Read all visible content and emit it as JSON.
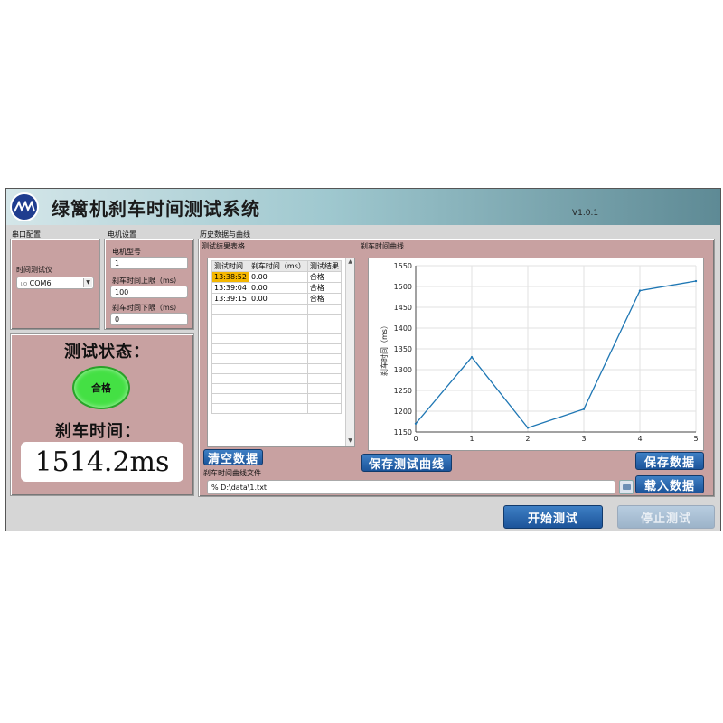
{
  "app": {
    "title": "绿篱机刹车时间测试系统",
    "version": "V1.0.1"
  },
  "sections": {
    "serial": "串口配置",
    "motor": "电机设置",
    "history": "历史数据与曲线",
    "results_table": "测试结果表格",
    "brake_chart": "刹车时间曲线"
  },
  "serial": {
    "instrument_label": "时间测试仪",
    "port_value": "COM6",
    "port_prefix": "I/O"
  },
  "motor": {
    "model_label": "电机型号",
    "model_value": "1",
    "upper_label": "刹车时间上限（ms）",
    "upper_value": "100",
    "lower_label": "刹车时间下限（ms）",
    "lower_value": "0"
  },
  "status": {
    "status_title": "测试状态：",
    "indicator_text": "合格",
    "brake_title": "刹车时间：",
    "brake_value": "1514.2ms",
    "indicator_color": "#44e044"
  },
  "table": {
    "headers": [
      "测试时间",
      "刹车时间（ms）",
      "测试结果"
    ],
    "rows": [
      [
        "13:38:52",
        "0.00",
        "合格"
      ],
      [
        "13:39:04",
        "0.00",
        "合格"
      ],
      [
        "13:39:15",
        "0.00",
        "合格"
      ]
    ],
    "selected_row": 0
  },
  "chart_data": {
    "type": "line",
    "title": "",
    "xlabel": "",
    "ylabel": "刹车时间（ms）",
    "x": [
      0,
      1,
      2,
      3,
      4,
      5
    ],
    "series": [
      {
        "values": [
          1170,
          1330,
          1160,
          1205,
          1490,
          1513
        ]
      }
    ],
    "xlim": [
      0,
      5
    ],
    "ylim": [
      1150,
      1550
    ],
    "yticks": [
      1150,
      1200,
      1250,
      1300,
      1350,
      1400,
      1450,
      1500,
      1550
    ],
    "xticks": [
      0,
      1,
      2,
      3,
      4,
      5
    ],
    "grid": true,
    "line_color": "#1f77b4"
  },
  "buttons": {
    "clear": "清空数据",
    "save_curve": "保存测试曲线",
    "save_data": "保存数据",
    "load_data": "载入数据",
    "start": "开始测试",
    "stop": "停止测试"
  },
  "file": {
    "label": "刹车时间曲线文件",
    "path": "D:\\data\\1.txt",
    "prefix": "%"
  }
}
